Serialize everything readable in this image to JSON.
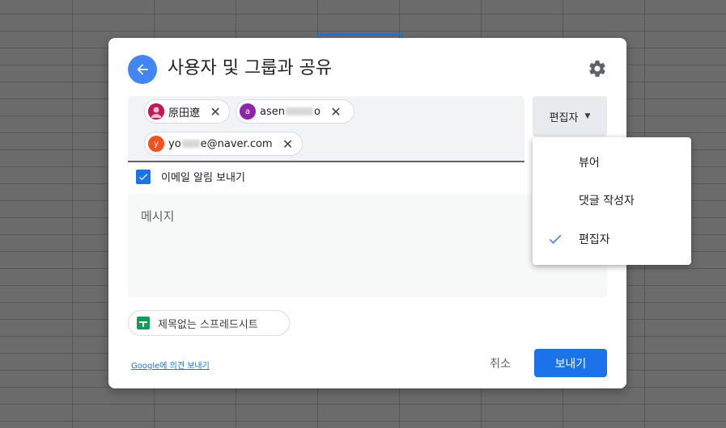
{
  "dialog": {
    "title": "사용자 및 그룹과 공유",
    "recipients": [
      {
        "avatar_letter": "",
        "avatar_color": "#c2185b",
        "name": "原田遼",
        "name_suffix": ""
      },
      {
        "avatar_letter": "a",
        "avatar_color": "#8e24aa",
        "name": "asen",
        "name_suffix": "o"
      },
      {
        "avatar_letter": "y",
        "avatar_color": "#f4511e",
        "name": "yo",
        "name_suffix": "e@naver.com"
      }
    ],
    "role_selected": "편집자",
    "notify_label": "이메일 알림 보내기",
    "message_placeholder": "메시지",
    "file_name": "제목없는 스프레드시트",
    "feedback_link": "Google에 의견 보내기",
    "cancel_label": "취소",
    "send_label": "보내기"
  },
  "role_menu": {
    "items": [
      {
        "label": "뷰어",
        "checked": false
      },
      {
        "label": "댓글 작성자",
        "checked": false
      },
      {
        "label": "편집자",
        "checked": true
      }
    ]
  },
  "colors": {
    "accent": "#1a73e8",
    "back_button": "#4285f4",
    "sheets_green": "#0f9d58"
  },
  "icons": [
    "arrow-left-icon",
    "gear-icon",
    "close-icon",
    "caret-down-icon",
    "checkbox-checked-icon",
    "sheets-icon",
    "check-icon"
  ]
}
